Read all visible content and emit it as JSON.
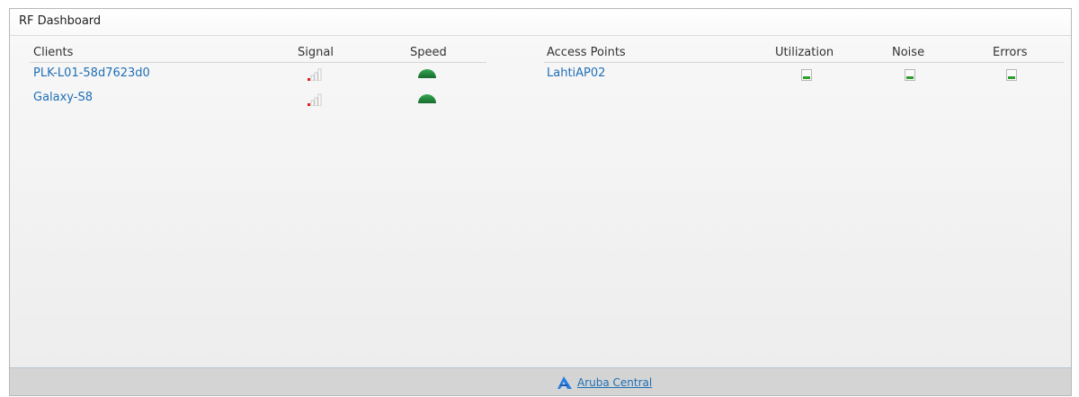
{
  "panel": {
    "title": "RF Dashboard"
  },
  "clients": {
    "headers": {
      "name": "Clients",
      "signal": "Signal",
      "speed": "Speed"
    },
    "rows": [
      {
        "name": "PLK-L01-58d7623d0",
        "signal_icon": "signal-low-icon",
        "speed_icon": "speed-gauge-icon"
      },
      {
        "name": "Galaxy-S8",
        "signal_icon": "signal-low-icon",
        "speed_icon": "speed-gauge-icon"
      }
    ]
  },
  "access_points": {
    "headers": {
      "name": "Access Points",
      "utilization": "Utilization",
      "noise": "Noise",
      "errors": "Errors"
    },
    "rows": [
      {
        "name": "LahtiAP02",
        "utilization_icon": "meter-low-icon",
        "noise_icon": "meter-low-icon",
        "errors_icon": "meter-low-icon"
      }
    ]
  },
  "footer": {
    "link_label": "Aruba Central",
    "icon": "aruba-logo-icon"
  },
  "colors": {
    "link": "#1f6fb5",
    "signal_low": "#e02020",
    "speed_green": "#1f8a3a",
    "meter_green": "#2e9e2e",
    "footer_bg": "#d4d4d4"
  }
}
